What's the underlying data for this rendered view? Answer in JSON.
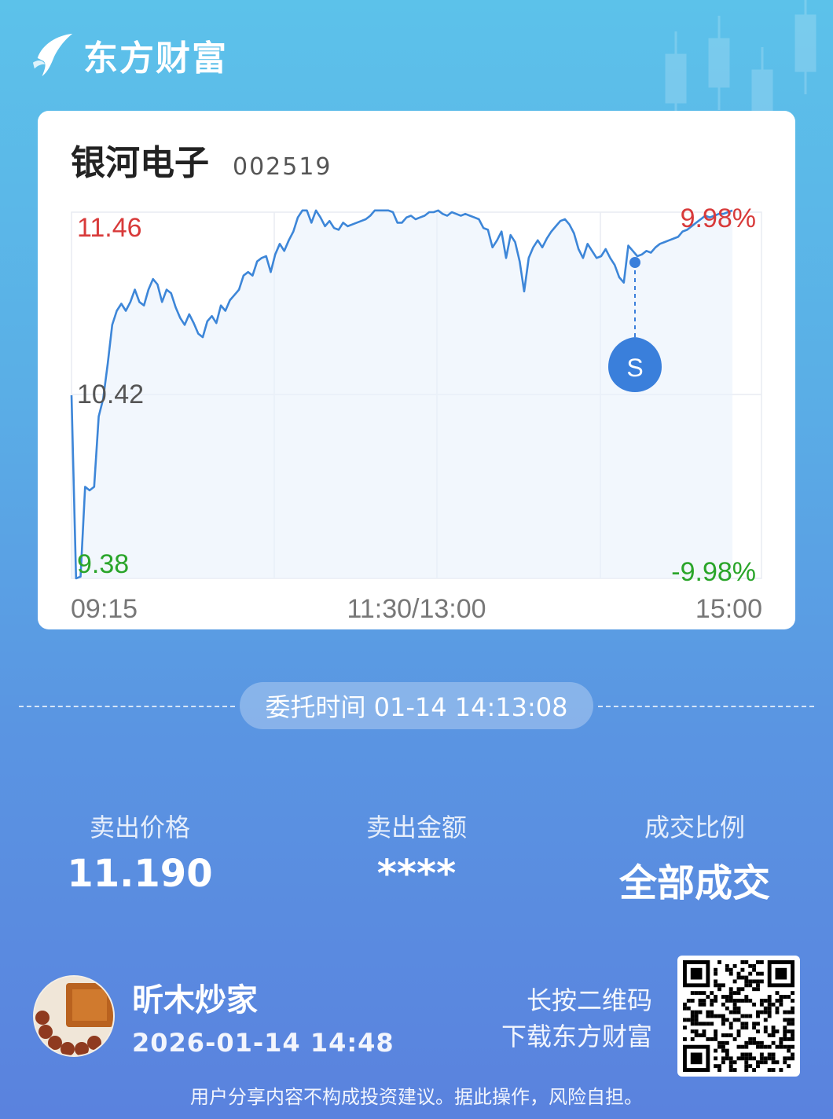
{
  "brand": {
    "name": "东方财富"
  },
  "stock": {
    "name": "银河电子",
    "code": "002519"
  },
  "chart": {
    "price_high_label": "11.46",
    "price_mid_label": "10.42",
    "price_low_label": "9.38",
    "pct_high_label": "9.98%",
    "pct_low_label": "-9.98%",
    "time_start_label": "09:15",
    "time_mid_label": "11:30/13:00",
    "time_end_label": "15:00",
    "marker_label": "S",
    "colors": {
      "up": "#d83a3a",
      "down": "#2aa52a",
      "line": "#3d86d8",
      "marker": "#3a7fdb"
    }
  },
  "chart_data": {
    "type": "line",
    "ylim": [
      9.38,
      11.46
    ],
    "x_ticks": [
      "09:15",
      "11:30/13:00",
      "15:00"
    ],
    "y_ticks": [
      "9.38",
      "10.42",
      "11.46"
    ],
    "pct_ticks": [
      "-9.98%",
      "9.98%"
    ],
    "series": [
      {
        "values": [
          10.42,
          9.38,
          9.39,
          9.9,
          9.88,
          9.9,
          10.3,
          10.4,
          10.6,
          10.82,
          10.9,
          10.94,
          10.9,
          10.95,
          11.02,
          10.95,
          10.93,
          11.02,
          11.08,
          11.05,
          10.95,
          11.02,
          11.0,
          10.92,
          10.86,
          10.82,
          10.88,
          10.83,
          10.77,
          10.75,
          10.84,
          10.87,
          10.83,
          10.93,
          10.9,
          10.96,
          10.99,
          11.02,
          11.1,
          11.12,
          11.1,
          11.18,
          11.2,
          11.21,
          11.12,
          11.22,
          11.28,
          11.24,
          11.3,
          11.35,
          11.43,
          11.47,
          11.47,
          11.4,
          11.47,
          11.43,
          11.38,
          11.41,
          11.37,
          11.36,
          11.4,
          11.38,
          11.39,
          11.4,
          11.41,
          11.42,
          11.44,
          11.47,
          11.47,
          11.47,
          11.47,
          11.46,
          11.4,
          11.4,
          11.43,
          11.44,
          11.42,
          11.43,
          11.44,
          11.46,
          11.46,
          11.47,
          11.45,
          11.44,
          11.46,
          11.45,
          11.44,
          11.45,
          11.44,
          11.43,
          11.42,
          11.37,
          11.36,
          11.26,
          11.3,
          11.35,
          11.2,
          11.33,
          11.29,
          11.18,
          11.01,
          11.2,
          11.26,
          11.3,
          11.26,
          11.31,
          11.35,
          11.38,
          11.41,
          11.42,
          11.39,
          11.34,
          11.25,
          11.2,
          11.28,
          11.24,
          11.2,
          11.21,
          11.25,
          11.2,
          11.16,
          11.09,
          11.06,
          11.27,
          11.24,
          11.21,
          11.22,
          11.24,
          11.23,
          11.26,
          11.28,
          11.29,
          11.3,
          11.31,
          11.32,
          11.35,
          11.36,
          11.38,
          11.4,
          11.42,
          11.44,
          11.43,
          11.44,
          11.45,
          11.45,
          11.46,
          11.47
        ]
      }
    ],
    "marker": {
      "label": "S",
      "price": 11.19,
      "time": "14:13:08"
    }
  },
  "order": {
    "time_text": "委托时间 01-14 14:13:08"
  },
  "stats": [
    {
      "label": "卖出价格",
      "value": "11.190"
    },
    {
      "label": "卖出金额",
      "value": "****"
    },
    {
      "label": "成交比例",
      "value": "全部成交"
    }
  ],
  "user": {
    "name": "昕木炒家",
    "time": "2026-01-14 14:48"
  },
  "qr": {
    "hint_line1": "长按二维码",
    "hint_line2": "下载东方财富"
  },
  "disclaimer": "用户分享内容不构成投资建议。据此操作，风险自担。",
  "icons": {
    "brand": "eastmoney-logo-icon",
    "qr": "qr-code-icon",
    "avatar": "user-avatar"
  }
}
